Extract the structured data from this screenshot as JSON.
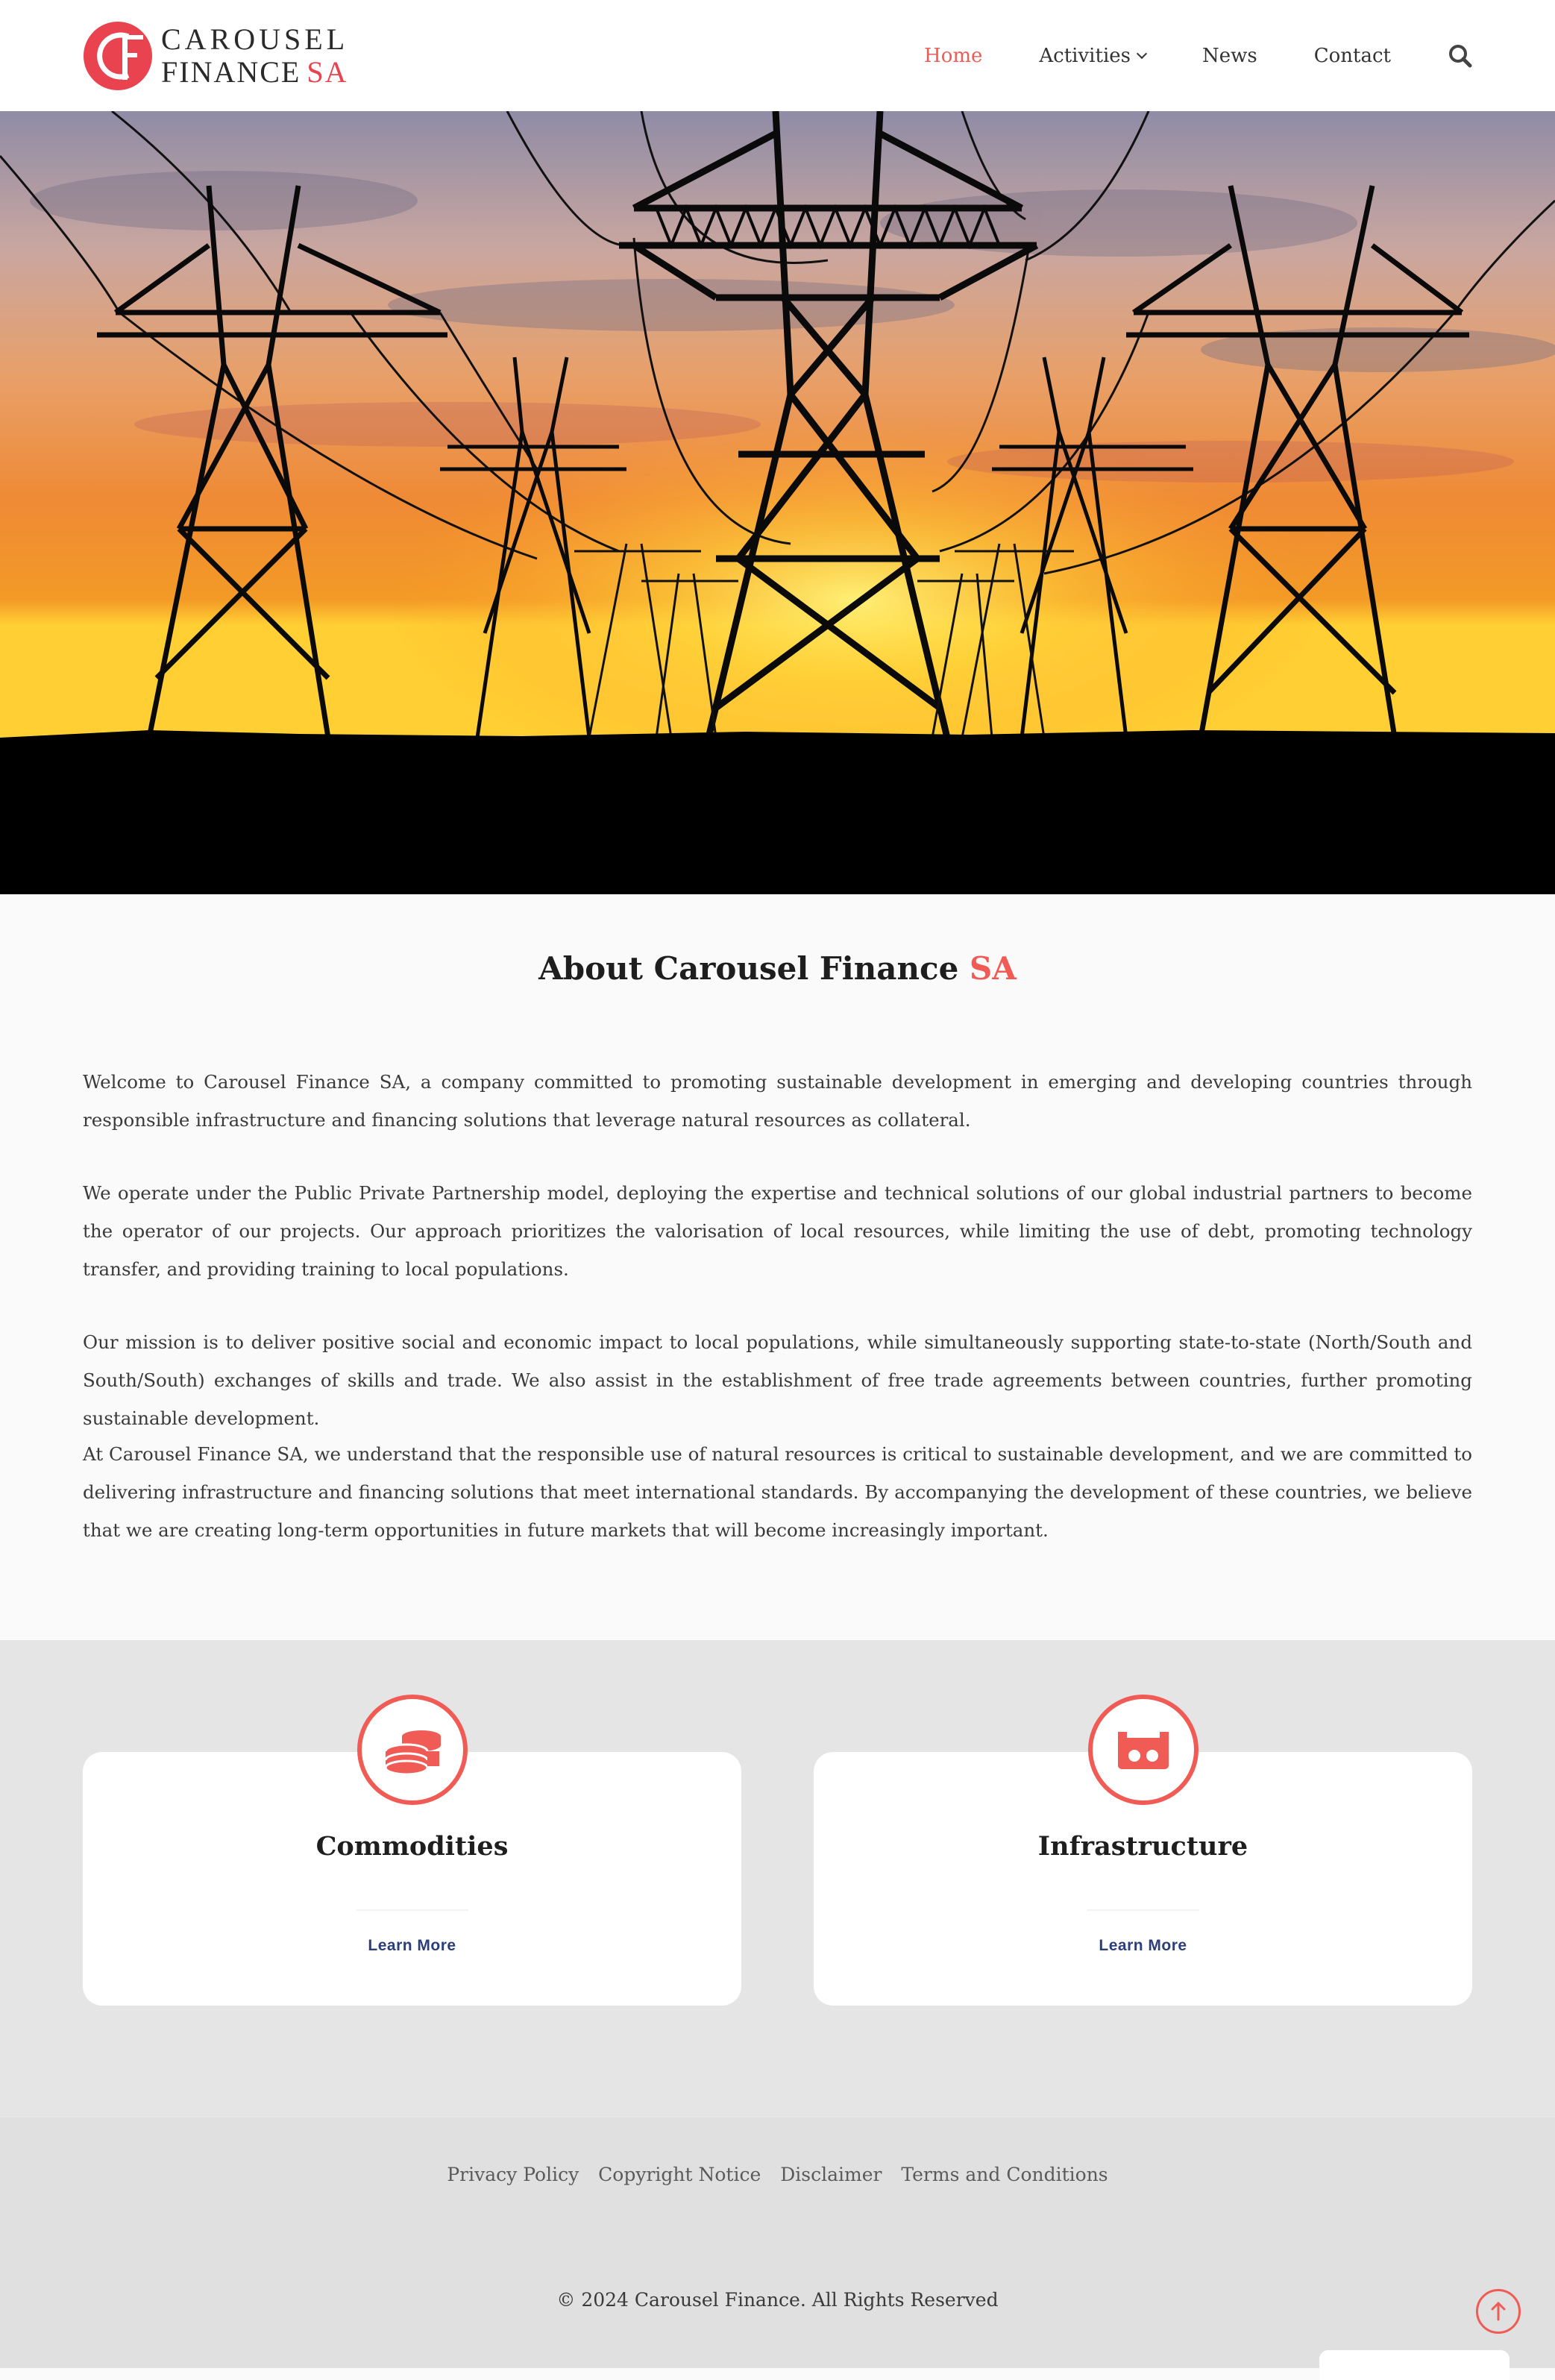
{
  "brand": {
    "line1": "CAROUSEL",
    "line2": "FINANCE",
    "line2_accent": "SA",
    "accent_color": "#f15b55"
  },
  "nav": {
    "items": [
      {
        "label": "Home",
        "active": true
      },
      {
        "label": "Activities",
        "has_dropdown": true
      },
      {
        "label": "News"
      },
      {
        "label": "Contact"
      }
    ],
    "search_icon": "search-icon"
  },
  "about": {
    "title": "About Carousel Finance",
    "title_accent": "SA",
    "paragraphs": [
      "Welcome to Carousel Finance SA, a company committed to promoting sustainable development in emerging and developing countries through responsible infrastructure and financing solutions that leverage natural resources as collateral.",
      "We operate under the Public Private Partnership model, deploying the expertise and technical solutions of our global industrial partners to become the operator of our projects. Our approach prioritizes the valorisation of local resources, while limiting the use of debt, promoting technology transfer, and providing training to local populations.",
      "Our mission is to deliver positive social and economic impact to local populations, while simultaneously supporting state-to-state (North/South and South/South) exchanges of skills and trade. We also assist in the establishment of free trade agreements between countries, further promoting sustainable development.",
      "At Carousel Finance SA, we understand that the responsible use of natural resources is critical to sustainable development, and we are committed to delivering infrastructure and financing solutions that meet international standards. By accompanying the development of these countries, we believe that we are creating long-term opportunities in future markets that will become increasingly important."
    ]
  },
  "cards": [
    {
      "title": "Commodities",
      "link": "Learn More",
      "icon": "coins-icon"
    },
    {
      "title": "Infrastructure",
      "link": "Learn More",
      "icon": "infrastructure-icon"
    }
  ],
  "footer": {
    "links": [
      "Privacy Policy",
      "Copyright Notice",
      "Disclaimer",
      "Terms and Conditions"
    ],
    "copyright": "© 2024 Carousel Finance. All Rights Reserved"
  }
}
